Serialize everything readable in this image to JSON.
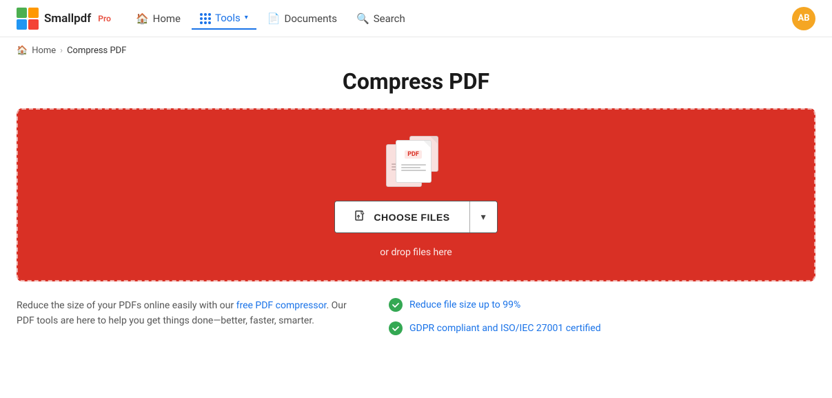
{
  "header": {
    "logo_text": "Smallpdf",
    "logo_pro": "Pro",
    "nav": [
      {
        "label": "Home",
        "icon": "home-icon",
        "active": false
      },
      {
        "label": "Tools",
        "icon": "grid-icon",
        "active": true,
        "dropdown": true
      },
      {
        "label": "Documents",
        "icon": "doc-icon",
        "active": false
      },
      {
        "label": "Search",
        "icon": "search-icon",
        "active": false
      }
    ],
    "avatar_initials": "AB"
  },
  "breadcrumb": {
    "home_label": "Home",
    "separator": "›",
    "current": "Compress PDF"
  },
  "page_title": "Compress PDF",
  "dropzone": {
    "choose_files_label": "CHOOSE FILES",
    "drop_text": "or drop files here"
  },
  "description": {
    "text_part1": "Reduce the size of your PDFs online easily with our free PDF compressor. Our PDF tools are here to help you get things done",
    "text_dash": "—",
    "text_part2": "better, faster, smarter."
  },
  "features": [
    {
      "text": "Reduce file size up to 99%"
    },
    {
      "text": "GDPR compliant and ISO/IEC 27001 certified"
    }
  ]
}
